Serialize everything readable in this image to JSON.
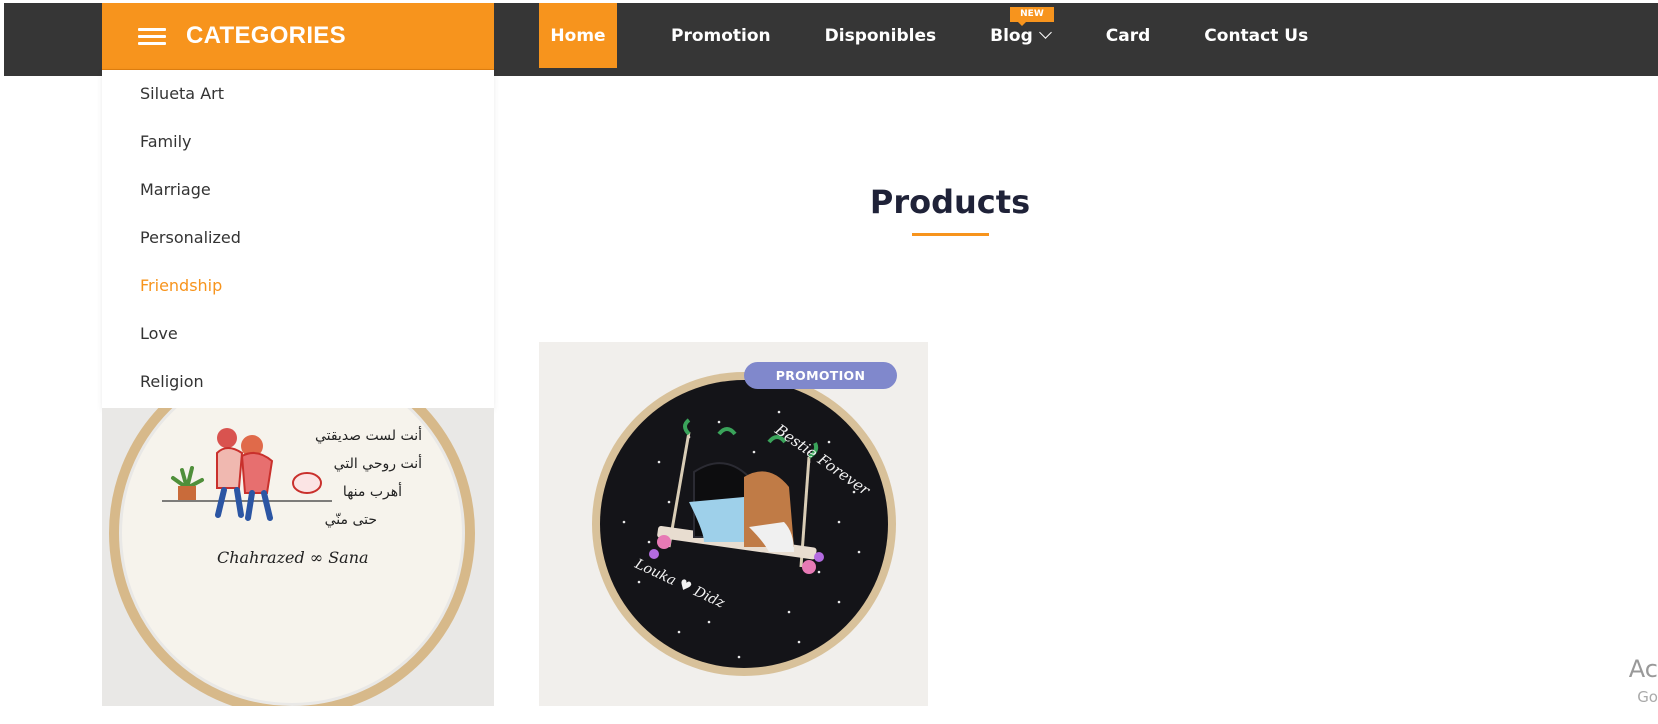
{
  "header": {
    "categories_label": "CATEGORIES",
    "nav": [
      {
        "label": "Home"
      },
      {
        "label": "Promotion"
      },
      {
        "label": "Disponibles"
      },
      {
        "label": "Blog",
        "badge": "NEW"
      },
      {
        "label": "Card"
      },
      {
        "label": "Contact Us"
      }
    ]
  },
  "categories": {
    "items": [
      "Silueta Art",
      "Family",
      "Marriage",
      "Personalized",
      "Friendship",
      "Love",
      "Religion"
    ],
    "active": "Friendship"
  },
  "main": {
    "title": "Products",
    "products": [
      {
        "image_text": [
          "أنت لست صديقتي",
          "أنت روحي التي",
          "أهرب منها",
          "حتى منّي"
        ],
        "names": "Chahrazed ∞ Sana"
      },
      {
        "badge": "PROMOTION",
        "image_text_top": "Bestie Forever",
        "image_text_bottom": "Louka ♥ Didz"
      }
    ]
  },
  "corner": {
    "line1": "Ac",
    "line2": "Go"
  },
  "colors": {
    "accent": "#f7941d",
    "nav_bg": "#363636",
    "promo_badge": "#8088cc",
    "title": "#1f2238"
  }
}
